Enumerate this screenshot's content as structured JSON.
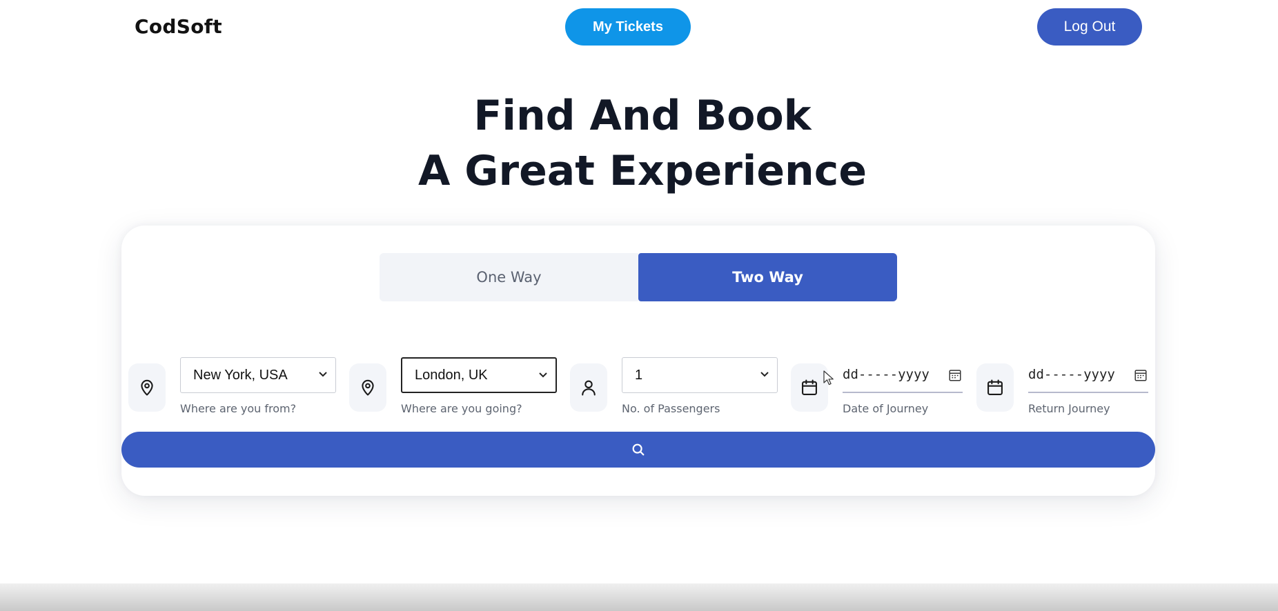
{
  "header": {
    "logo": "CodSoft",
    "my_tickets": "My Tickets",
    "logout": "Log Out"
  },
  "hero": {
    "line1": "Find And Book",
    "line2": "A Great Experience"
  },
  "trip_type": {
    "options": [
      "One Way",
      "Two Way"
    ],
    "selected": "Two Way"
  },
  "fields": {
    "from": {
      "value": "New York, USA",
      "hint": "Where are you from?",
      "icon": "location-pin-icon"
    },
    "to": {
      "value": "London, UK",
      "hint": "Where are you going?",
      "icon": "location-pin-icon"
    },
    "passengers": {
      "value": "1",
      "hint": "No. of Passengers",
      "icon": "user-icon"
    },
    "journey_date": {
      "placeholder": "dd-----yyyy",
      "hint": "Date of Journey",
      "icon": "calendar-icon"
    },
    "return_date": {
      "placeholder": "dd-----yyyy",
      "hint": "Return Journey",
      "icon": "calendar-icon"
    }
  },
  "search": {
    "icon": "search-icon"
  },
  "colors": {
    "primary": "#3a5cc2",
    "tickets_button": "#0f95e8",
    "text_dark": "#121826",
    "hint_text": "#5d6470"
  }
}
